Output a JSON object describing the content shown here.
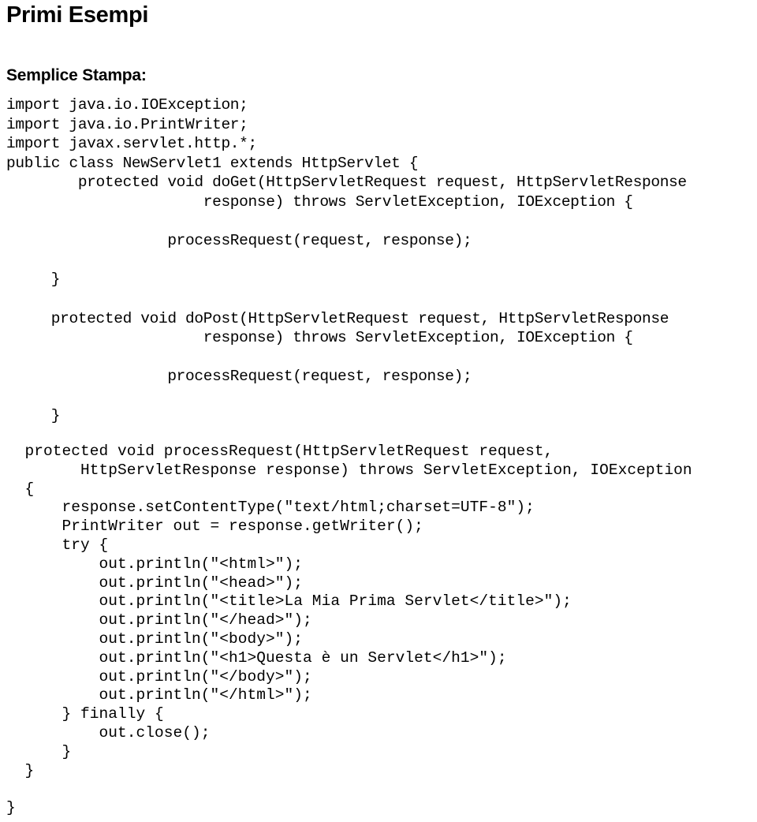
{
  "document": {
    "title": "Primi Esempi",
    "section_heading": "Semplice Stampa:",
    "code_block_1": {
      "language": "java",
      "lines": [
        "import java.io.IOException;",
        "import java.io.PrintWriter;",
        "import javax.servlet.http.*;",
        "public class NewServlet1 extends HttpServlet {",
        "        protected void doGet(HttpServletRequest request, HttpServletResponse",
        "                      response) throws ServletException, IOException {",
        "",
        "                  processRequest(request, response);",
        "",
        "     }",
        "",
        "     protected void doPost(HttpServletRequest request, HttpServletResponse",
        "                      response) throws ServletException, IOException {",
        "",
        "                  processRequest(request, response);",
        "",
        "     }"
      ]
    },
    "code_block_2": {
      "language": "java",
      "lines": [
        "  protected void processRequest(HttpServletRequest request,",
        "        HttpServletResponse response) throws ServletException, IOException",
        "  {",
        "      response.setContentType(\"text/html;charset=UTF-8\");",
        "      PrintWriter out = response.getWriter();",
        "      try {",
        "          out.println(\"<html>\");",
        "          out.println(\"<head>\");",
        "          out.println(\"<title>La Mia Prima Servlet</title>\");",
        "          out.println(\"</head>\");",
        "          out.println(\"<body>\");",
        "          out.println(\"<h1>Questa è un Servlet</h1>\");",
        "          out.println(\"</body>\");",
        "          out.println(\"</html>\");",
        "      } finally {",
        "          out.close();",
        "      }",
        "  }",
        "",
        "}"
      ]
    }
  },
  "colors": {
    "page_background": "#ffffff",
    "text": "#000000"
  }
}
